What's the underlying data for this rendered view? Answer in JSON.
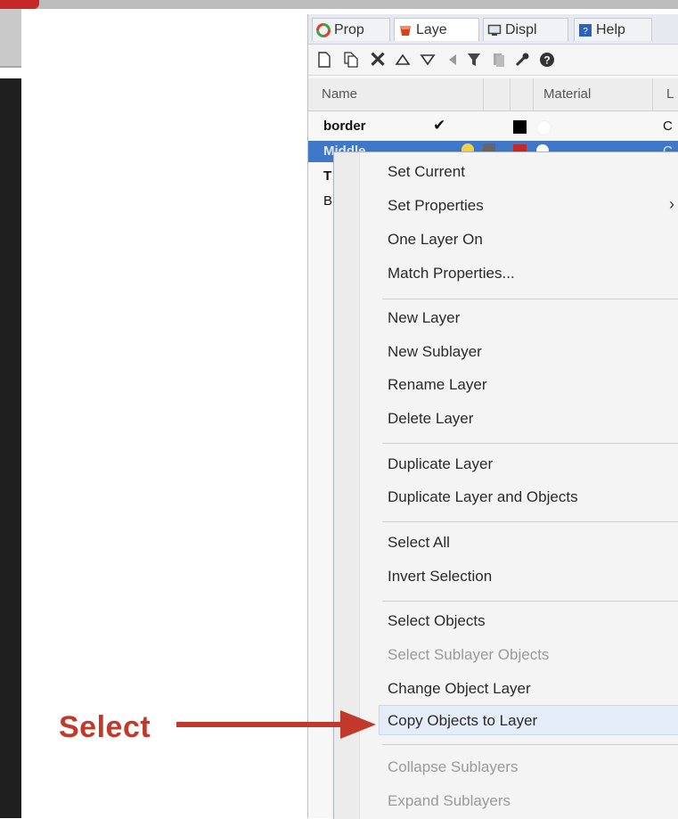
{
  "tabs": [
    {
      "label": "Prop",
      "icon": "properties-icon"
    },
    {
      "label": "Laye",
      "icon": "layers-icon"
    },
    {
      "label": "Displ",
      "icon": "display-icon"
    },
    {
      "label": "Help",
      "icon": "help-icon"
    }
  ],
  "toolbar": {
    "icons": [
      "new-layer-icon",
      "new-sublayer-icon",
      "delete-icon",
      "move-up-icon",
      "move-down-icon",
      "move-left-icon",
      "filter-icon",
      "copy-icon",
      "tools-icon",
      "help-icon"
    ]
  },
  "table": {
    "columns": {
      "name": "Name",
      "material": "Material",
      "extra": "L"
    },
    "rows": [
      {
        "name": "border",
        "check": "✔",
        "trailing": "C"
      },
      {
        "name": "Middle",
        "trailing": "C"
      },
      {
        "name": "T"
      },
      {
        "name": "B"
      }
    ]
  },
  "menu": {
    "items": [
      {
        "label": "Set Current",
        "disabled": false
      },
      {
        "label": "Set Properties",
        "disabled": false,
        "submenu": true
      },
      {
        "label": "One Layer On",
        "disabled": false
      },
      {
        "label": "Match Properties...",
        "disabled": false
      },
      {
        "label": "New Layer",
        "disabled": false
      },
      {
        "label": "New Sublayer",
        "disabled": false
      },
      {
        "label": "Rename Layer",
        "disabled": false
      },
      {
        "label": "Delete Layer",
        "disabled": false
      },
      {
        "label": "Duplicate Layer",
        "disabled": false
      },
      {
        "label": "Duplicate Layer and Objects",
        "disabled": false
      },
      {
        "label": "Select All",
        "disabled": false
      },
      {
        "label": "Invert Selection",
        "disabled": false
      },
      {
        "label": "Select Objects",
        "disabled": false
      },
      {
        "label": "Select Sublayer Objects",
        "disabled": true
      },
      {
        "label": "Change Object Layer",
        "disabled": false
      },
      {
        "label": "Copy Objects to Layer",
        "disabled": false,
        "highlighted": true
      },
      {
        "label": "Collapse Sublayers",
        "disabled": true
      },
      {
        "label": "Expand Sublayers",
        "disabled": true
      }
    ],
    "submenu_marker": "›"
  },
  "annotation": {
    "text": "Select",
    "color": "#c0392b"
  },
  "colors": {
    "selection": "#3f78c9",
    "accent_red": "#c62828"
  }
}
